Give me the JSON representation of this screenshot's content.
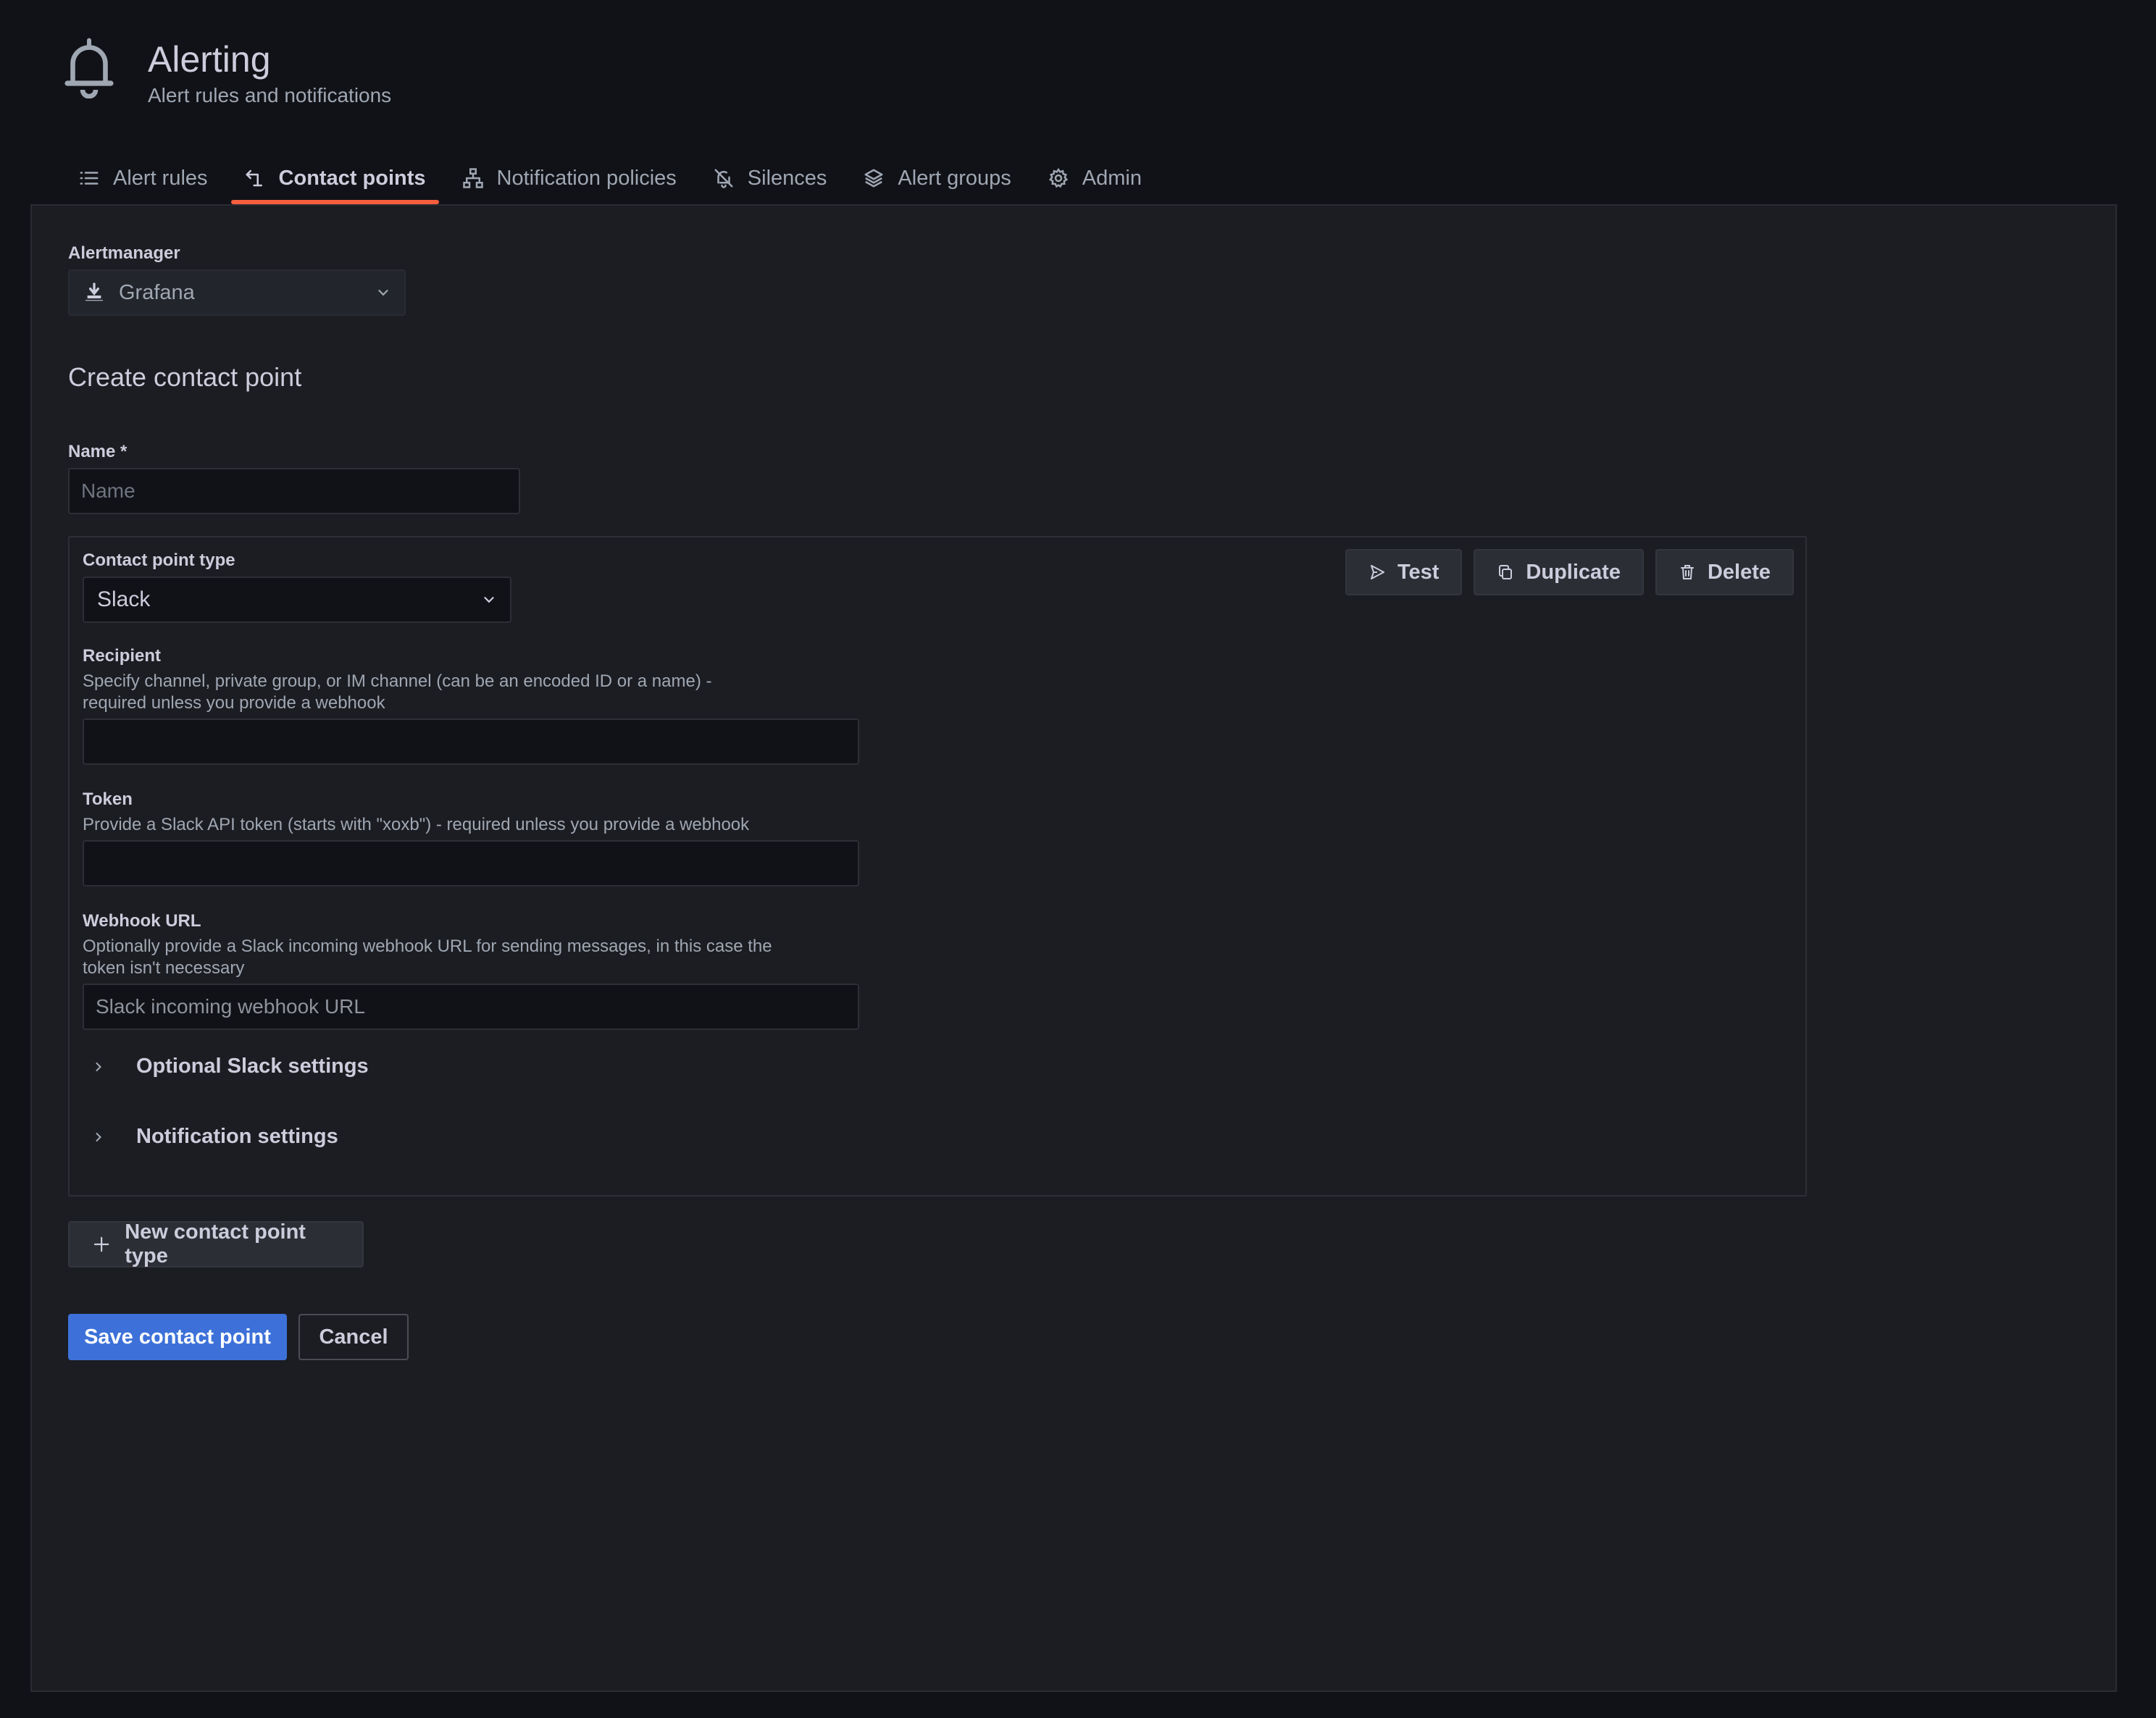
{
  "header": {
    "icon": "bell-icon",
    "title": "Alerting",
    "subtitle": "Alert rules and notifications"
  },
  "tabs": [
    {
      "label": "Alert rules",
      "icon": "list-icon",
      "active": false
    },
    {
      "label": "Contact points",
      "icon": "contact-points-icon",
      "active": true
    },
    {
      "label": "Notification policies",
      "icon": "sitemap-icon",
      "active": false
    },
    {
      "label": "Silences",
      "icon": "bell-slash-icon",
      "active": false
    },
    {
      "label": "Alert groups",
      "icon": "layer-group-icon",
      "active": false
    },
    {
      "label": "Admin",
      "icon": "cog-icon",
      "active": false
    }
  ],
  "alertmanager": {
    "label": "Alertmanager",
    "selected": "Grafana"
  },
  "form": {
    "title": "Create contact point",
    "name_label": "Name *",
    "name_placeholder": "Name",
    "name_value": "",
    "contact_point_type_label": "Contact point type",
    "contact_point_type_value": "Slack",
    "actions": {
      "test": "Test",
      "duplicate": "Duplicate",
      "delete": "Delete"
    },
    "recipient": {
      "label": "Recipient",
      "description": "Specify channel, private group, or IM channel (can be an encoded ID or a name) - required unless you provide a webhook",
      "value": ""
    },
    "token": {
      "label": "Token",
      "description": "Provide a Slack API token (starts with \"xoxb\") - required unless you provide a webhook",
      "value": ""
    },
    "webhook_url": {
      "label": "Webhook URL",
      "description": "Optionally provide a Slack incoming webhook URL for sending messages, in this case the token isn't necessary",
      "placeholder": "Slack incoming webhook URL",
      "value": ""
    },
    "optional_settings": "Optional Slack settings",
    "notification_settings": "Notification settings",
    "new_type_button": "New contact point type",
    "save_button": "Save contact point",
    "cancel_button": "Cancel"
  },
  "colors": {
    "page_bg": "#111217",
    "panel_bg": "#1c1d22",
    "active_tab_underline": "#f55f3e",
    "primary_button": "#3d71d9"
  }
}
